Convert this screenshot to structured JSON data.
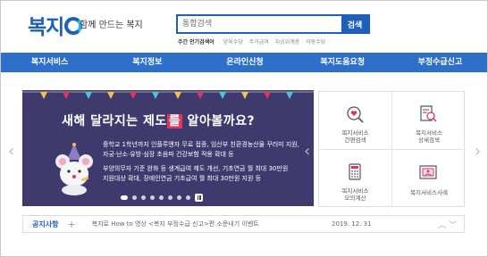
{
  "header": {
    "logo_text": "복지",
    "slogan": "함께 만드는 복지",
    "search_placeholder": "통합검색",
    "search_button": "검색",
    "popular_label": "주간 인기검색어",
    "popular_keywords": [
      "양육수당",
      "주거급여",
      "차상위계층",
      "아동수당"
    ]
  },
  "nav": {
    "items": [
      "복지서비스",
      "복지정보",
      "온라인신청",
      "복지도움요청",
      "부정수급신고"
    ]
  },
  "banner": {
    "title_pre": "새해 달라지는 제도",
    "title_hl": "를",
    "title_post": " 알아볼까요?",
    "lines": [
      "중학교 1학년까지 인플루엔자 무료 접종, 임산부 친환경농산물 꾸러미 지원,",
      "자궁·난소·유방·심장 초음파 건강보험 적용 확대 등",
      "부양의무자 기준 완화 등 생계급여 제도 개선, 기초연금 월 최대 30만원",
      "지원대상 확대, 장애인연금 기초급여 월 최대 30만원 지원 등"
    ],
    "slide_count": 8,
    "active_slide": 1
  },
  "quick_menu": {
    "items": [
      {
        "line1": "복지서비스",
        "line2": "간편검색",
        "icon": "heart-search-icon"
      },
      {
        "line1": "복지서비스",
        "line2": "상세검색",
        "icon": "document-search-icon"
      },
      {
        "line1": "복지서비스",
        "line2": "모의계산",
        "icon": "calculator-icon"
      },
      {
        "line1": "복지서비스사례",
        "line2": "",
        "icon": "case-image-icon"
      }
    ]
  },
  "notice": {
    "label": "공지사항",
    "plus": "+",
    "text": "복지로 How to 영상 <복지 부정수급 신고>편 소문내기 이벤트",
    "date": "2019. 12. 31"
  },
  "colors": {
    "brand": "#1e5fb8",
    "nav": "#2e6fc9",
    "banner_bg": "#3e3a6e",
    "highlight": "#e0365e",
    "icon_accent": "#e0365e"
  }
}
